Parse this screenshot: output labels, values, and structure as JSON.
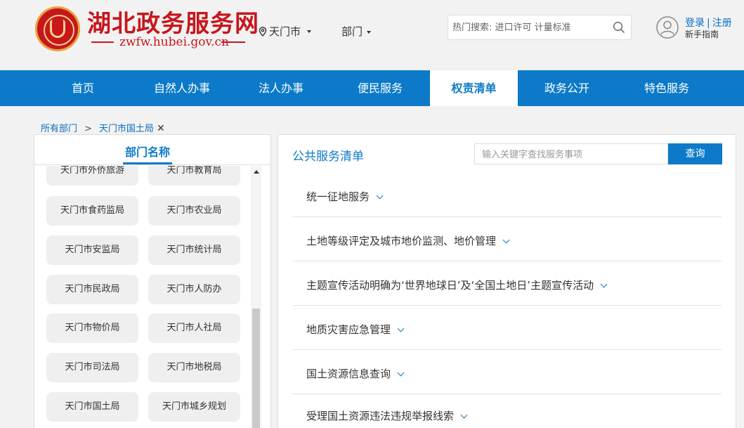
{
  "header": {
    "site_title": "湖北政务服务网",
    "site_url": "zwfw.hubei.gov.cn",
    "location": "天门市",
    "department": "部门",
    "search_placeholder": "热门搜索: 进口许可 计量标准",
    "login": "登录",
    "register": "注册",
    "guide": "新手指南",
    "brand_color": "#c8161d"
  },
  "nav": {
    "accent_color": "#0c7ac8",
    "items": [
      {
        "label": "首页"
      },
      {
        "label": "自然人办事"
      },
      {
        "label": "法人办事"
      },
      {
        "label": "便民服务"
      },
      {
        "label": "权责清单",
        "active": true
      },
      {
        "label": "政务公开"
      },
      {
        "label": "特色服务"
      }
    ]
  },
  "breadcrumb": {
    "root": "所有部门",
    "separator": ">",
    "current": "天门市国土局",
    "close": "✕"
  },
  "left_panel": {
    "title": "部门名称",
    "departments": [
      "天门市外侨旅游",
      "天门市教育局",
      "天门市食药监局",
      "天门市农业局",
      "天门市安监局",
      "天门市统计局",
      "天门市民政局",
      "天门市人防办",
      "天门市物价局",
      "天门市人社局",
      "天门市司法局",
      "天门市地税局",
      "天门市国土局",
      "天门市城乡规划"
    ]
  },
  "right_panel": {
    "title": "公共服务清单",
    "search_placeholder": "输入关键字查找服务事项",
    "search_button": "查询",
    "services": [
      "统一征地服务",
      "土地等级评定及城市地价监测、地价管理",
      "主题宣传活动明确为‘世界地球日’及‘全国土地日’主题宣传活动",
      "地质灾害应急管理",
      "国土资源信息查询",
      "受理国土资源违法违规举报线索"
    ]
  }
}
